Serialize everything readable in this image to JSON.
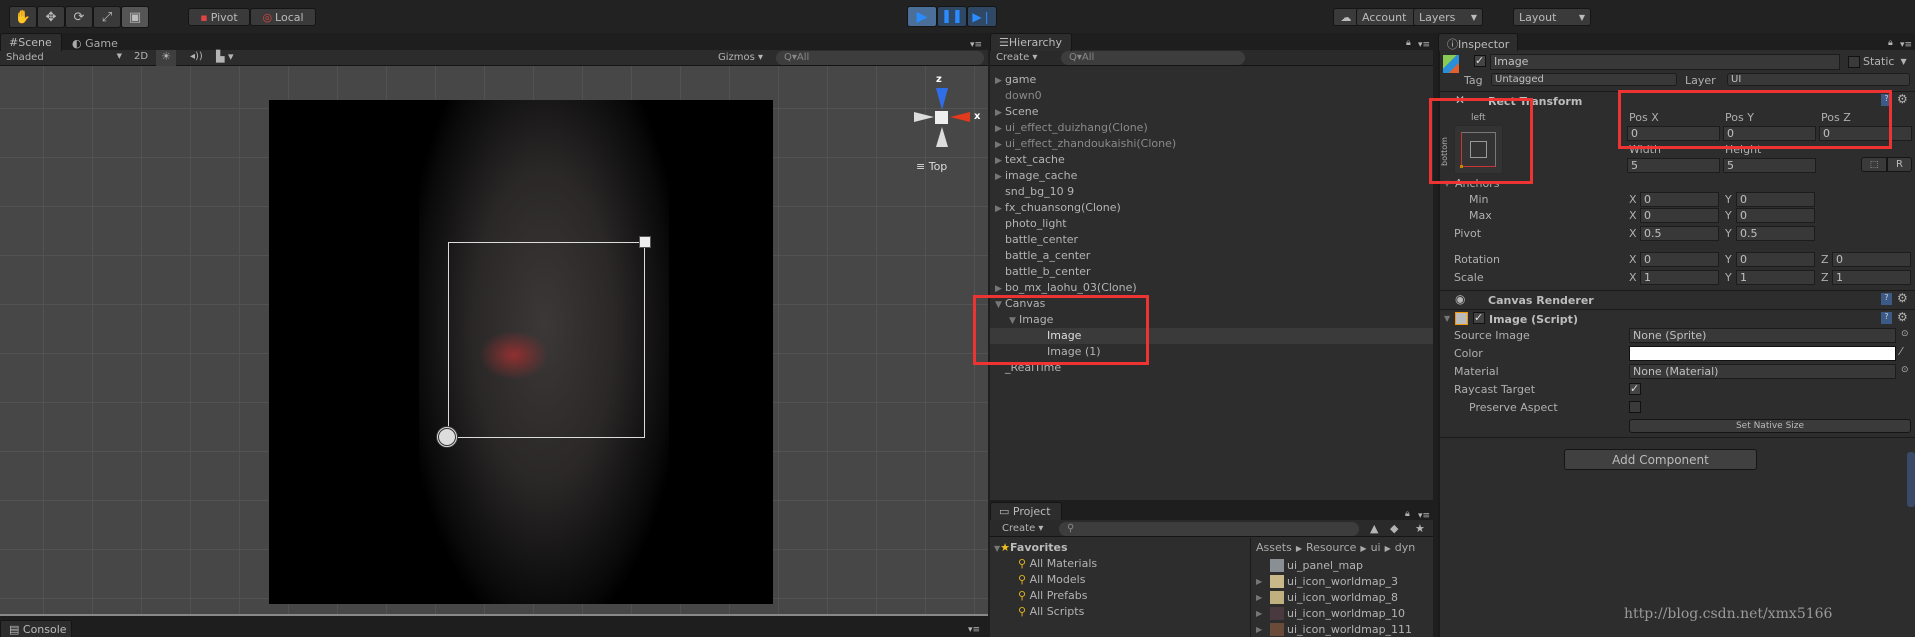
{
  "toolbar": {
    "tools": [
      "hand-tool",
      "move-tool",
      "rotate-tool",
      "scale-tool",
      "rect-tool"
    ],
    "pivot": "Pivot",
    "local": "Local",
    "account": "Account",
    "layers": "Layers",
    "layout": "Layout"
  },
  "scene": {
    "tab": "Scene",
    "game_tab": "Game",
    "shaded": "Shaded",
    "mode_2d": "2D",
    "gizmos": "Gizmos",
    "search": "All",
    "gizmo_axis_z": "z",
    "gizmo_axis_x": "x",
    "view_label": "Top"
  },
  "hierarchy": {
    "tab": "Hierarchy",
    "create": "Create",
    "search": "All",
    "items": [
      {
        "label": "game",
        "arrow": "▶",
        "indent": 0,
        "dim": false
      },
      {
        "label": "down0",
        "arrow": "",
        "indent": 0,
        "dim": true
      },
      {
        "label": "Scene",
        "arrow": "▶",
        "indent": 0,
        "dim": false
      },
      {
        "label": "ui_effect_duizhang(Clone)",
        "arrow": "▶",
        "indent": 0,
        "dim": true
      },
      {
        "label": "ui_effect_zhandoukaishi(Clone)",
        "arrow": "▶",
        "indent": 0,
        "dim": true
      },
      {
        "label": "text_cache",
        "arrow": "▶",
        "indent": 0,
        "dim": false
      },
      {
        "label": "image_cache",
        "arrow": "▶",
        "indent": 0,
        "dim": false
      },
      {
        "label": "snd_bg_10 9",
        "arrow": "",
        "indent": 0,
        "dim": false
      },
      {
        "label": "fx_chuansong(Clone)",
        "arrow": "▶",
        "indent": 0,
        "dim": false
      },
      {
        "label": "photo_light",
        "arrow": "",
        "indent": 0,
        "dim": false
      },
      {
        "label": "battle_center",
        "arrow": "",
        "indent": 0,
        "dim": false
      },
      {
        "label": "battle_a_center",
        "arrow": "",
        "indent": 0,
        "dim": false
      },
      {
        "label": "battle_b_center",
        "arrow": "",
        "indent": 0,
        "dim": false
      },
      {
        "label": "bo_mx_laohu_03(Clone)",
        "arrow": "▶",
        "indent": 0,
        "dim": false
      },
      {
        "label": "Canvas",
        "arrow": "▼",
        "indent": 0,
        "dim": false
      },
      {
        "label": "Image",
        "arrow": "▼",
        "indent": 1,
        "dim": false
      },
      {
        "label": "Image",
        "arrow": "",
        "indent": 2,
        "dim": false,
        "selected": true
      },
      {
        "label": "Image (1)",
        "arrow": "",
        "indent": 2,
        "dim": false
      },
      {
        "label": "_RealTime",
        "arrow": "",
        "indent": 0,
        "dim": false
      }
    ]
  },
  "project": {
    "tab": "Project",
    "create": "Create",
    "favorites": "Favorites",
    "fav_items": [
      "All Materials",
      "All Models",
      "All Prefabs",
      "All Scripts"
    ],
    "breadcrumb": [
      "Assets",
      "Resource",
      "ui",
      "dyn"
    ],
    "assets": [
      {
        "label": "ui_panel_map",
        "type": "folder"
      },
      {
        "label": "ui_icon_worldmap_3",
        "type": "sprite"
      },
      {
        "label": "ui_icon_worldmap_8",
        "type": "sprite"
      },
      {
        "label": "ui_icon_worldmap_10",
        "type": "sprite"
      },
      {
        "label": "ui_icon_worldmap_111",
        "type": "sprite"
      }
    ]
  },
  "console": {
    "tab": "Console"
  },
  "inspector": {
    "tab": "Inspector",
    "name": "Image",
    "static": "Static",
    "tag_label": "Tag",
    "tag": "Untagged",
    "layer_label": "Layer",
    "layer": "UI",
    "rect": {
      "title": "Rect Transform",
      "anchor_h": "left",
      "anchor_v": "bottom",
      "pos_x_label": "Pos X",
      "pos_y_label": "Pos Y",
      "pos_z_label": "Pos Z",
      "pos_x": "0",
      "pos_y": "0",
      "pos_z": "0",
      "width_label": "Width",
      "height_label": "Height",
      "width": "5",
      "height": "5",
      "raw": "R",
      "anchors": "Anchors",
      "min": "Min",
      "max": "Max",
      "min_x": "0",
      "min_y": "0",
      "max_x": "0",
      "max_y": "0",
      "pivot": "Pivot",
      "pivot_x": "0.5",
      "pivot_y": "0.5",
      "rotation": "Rotation",
      "rot_x": "0",
      "rot_y": "0",
      "rot_z": "0",
      "scale": "Scale",
      "scale_x": "1",
      "scale_y": "1",
      "scale_z": "1",
      "x": "X",
      "y": "Y",
      "z": "Z"
    },
    "canvas_renderer": "Canvas Renderer",
    "image_script": {
      "title": "Image (Script)",
      "source_label": "Source Image",
      "source": "None (Sprite)",
      "color_label": "Color",
      "color": "#ffffff",
      "material_label": "Material",
      "material": "None (Material)",
      "raycast_label": "Raycast Target",
      "raycast": true,
      "preserve_label": "Preserve Aspect",
      "preserve": false,
      "native": "Set Native Size"
    },
    "add_component": "Add Component"
  },
  "watermark": "http://blog.csdn.net/xmx5166",
  "colors": {
    "highlight": "#ee3333",
    "play_active": "#1e73d8"
  }
}
